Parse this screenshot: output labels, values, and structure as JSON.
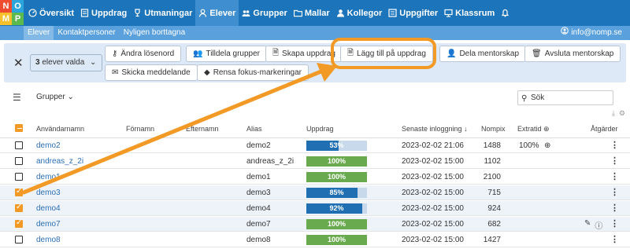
{
  "logo": {
    "letters": [
      "N",
      "O",
      "M",
      "P"
    ],
    "colors": [
      "#ef4c2f",
      "#2aa6dc",
      "#f6c02d",
      "#5cb94e"
    ]
  },
  "nav": [
    {
      "label": "Översikt",
      "icon": "dashboard-icon"
    },
    {
      "label": "Uppdrag",
      "icon": "assignment-icon"
    },
    {
      "label": "Utmaningar",
      "icon": "trophy-icon"
    },
    {
      "label": "Elever",
      "icon": "student-icon",
      "active": true
    },
    {
      "label": "Grupper",
      "icon": "groups-icon"
    },
    {
      "label": "Mallar",
      "icon": "folder-icon"
    },
    {
      "label": "Kollegor",
      "icon": "colleagues-icon"
    },
    {
      "label": "Uppgifter",
      "icon": "tasks-icon"
    },
    {
      "label": "Klassrum",
      "icon": "classroom-icon"
    }
  ],
  "subnav": [
    {
      "label": "Elever",
      "active": true
    },
    {
      "label": "Kontaktpersoner"
    },
    {
      "label": "Nyligen borttagna"
    }
  ],
  "user": {
    "email": "info@nomp.se",
    "icon": "user-icon"
  },
  "actionbar": {
    "selected_count": "3",
    "selected_suffix": "elever valda",
    "buttons": [
      {
        "label": "Ändra lösenord",
        "icon": "key-icon"
      },
      {
        "label": "Tilldela grupper",
        "icon": "groups-icon"
      },
      {
        "label": "Skapa uppdrag",
        "icon": "document-icon"
      },
      {
        "label": "Lägg till på uppdrag",
        "icon": "document-add-icon"
      },
      {
        "label": "Dela mentorskap",
        "icon": "share-user-icon"
      },
      {
        "label": "Avsluta mentorskap",
        "icon": "trash-icon"
      },
      {
        "label": "Skicka meddelande",
        "icon": "mail-icon"
      },
      {
        "label": "Rensa fokus-markeringar",
        "icon": "eraser-icon"
      }
    ]
  },
  "filter": {
    "groups_label": "Grupper",
    "search_placeholder": "Sök"
  },
  "table": {
    "headers": {
      "username": "Användarnamn",
      "firstname": "Förnamn",
      "lastname": "Efternamn",
      "alias": "Alias",
      "assignment": "Uppdrag",
      "last_login": "Senaste inloggning",
      "nompix": "Nompix",
      "extratime": "Extratid",
      "actions": "Åtgärder"
    },
    "rows": [
      {
        "username": "demo2",
        "alias": "demo2",
        "progress": 53,
        "pct": "53%",
        "color": "#1f6fb2",
        "login": "2023-02-02 21:06",
        "nompix": "1488",
        "extra": "100%",
        "selected": false
      },
      {
        "username": "andreas_z_2i",
        "alias": "andreas_z_2i",
        "progress": 100,
        "pct": "100%",
        "color": "#6aaa4e",
        "login": "2023-02-02 15:00",
        "nompix": "1102",
        "extra": "",
        "selected": false
      },
      {
        "username": "demo1",
        "alias": "demo1",
        "progress": 100,
        "pct": "100%",
        "color": "#6aaa4e",
        "login": "2023-02-02 15:00",
        "nompix": "2100",
        "extra": "",
        "selected": false
      },
      {
        "username": "demo3",
        "alias": "demo3",
        "progress": 85,
        "pct": "85%",
        "color": "#1f6fb2",
        "login": "2023-02-02 15:00",
        "nompix": "715",
        "extra": "",
        "selected": true
      },
      {
        "username": "demo4",
        "alias": "demo4",
        "progress": 92,
        "pct": "92%",
        "color": "#1f6fb2",
        "login": "2023-02-02 15:00",
        "nompix": "924",
        "extra": "",
        "selected": true
      },
      {
        "username": "demo7",
        "alias": "demo7",
        "progress": 100,
        "pct": "100%",
        "color": "#6aaa4e",
        "login": "2023-02-02 15:00",
        "nompix": "682",
        "extra": "",
        "selected": true
      },
      {
        "username": "demo8",
        "alias": "demo8",
        "progress": 100,
        "pct": "100%",
        "color": "#6aaa4e",
        "login": "2023-02-02 15:00",
        "nompix": "1427",
        "extra": "",
        "selected": false
      }
    ]
  },
  "colors": {
    "accent": "#f39a26",
    "primary": "#1c74bb"
  }
}
